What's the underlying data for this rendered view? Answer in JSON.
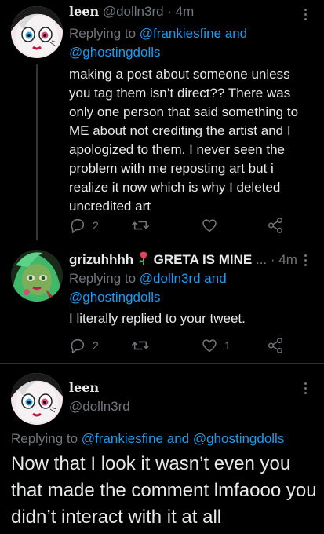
{
  "tweets": [
    {
      "name": "leen",
      "handle": "@dolln3rd",
      "time": "· 4m",
      "replying_prefix": "Replying to",
      "reply_user1": "@frankiesfine",
      "reply_and": "and",
      "reply_user2": "@ghostingdolls",
      "text": "making a post about someone unless you tag them isn’t direct?? There was only one person that said something to ME about not crediting the artist and I apologized to them. I never seen the problem with me reposting art but i realize it now which is why I deleted uncredited art",
      "reply_count": "2",
      "retweet_count": "",
      "like_count": ""
    },
    {
      "name": "grizuhhhh",
      "name_suffix": "GRETA IS MINE",
      "ellipsis": "...",
      "time": "· 4m",
      "replying_prefix": "Replying to",
      "reply_user1": "@dolln3rd",
      "reply_and": "and",
      "reply_user2": "@ghostingdolls",
      "text": "I literally replied to your tweet.",
      "reply_count": "2",
      "retweet_count": "",
      "like_count": "1"
    }
  ],
  "main_tweet": {
    "name": "leen",
    "handle": "@dolln3rd",
    "replying_prefix": "Replying to",
    "reply_user1": "@frankiesfine",
    "reply_and": "and",
    "reply_user2": "@ghostingdolls",
    "text": "Now that I look it wasn’t even you that made the comment lmfaooo you didn’t interact with it at all"
  },
  "colors": {
    "background": "#000000",
    "text": "#e7e9ea",
    "muted": "#71767b",
    "link": "#1d9bf0",
    "divider": "#2f3336"
  }
}
